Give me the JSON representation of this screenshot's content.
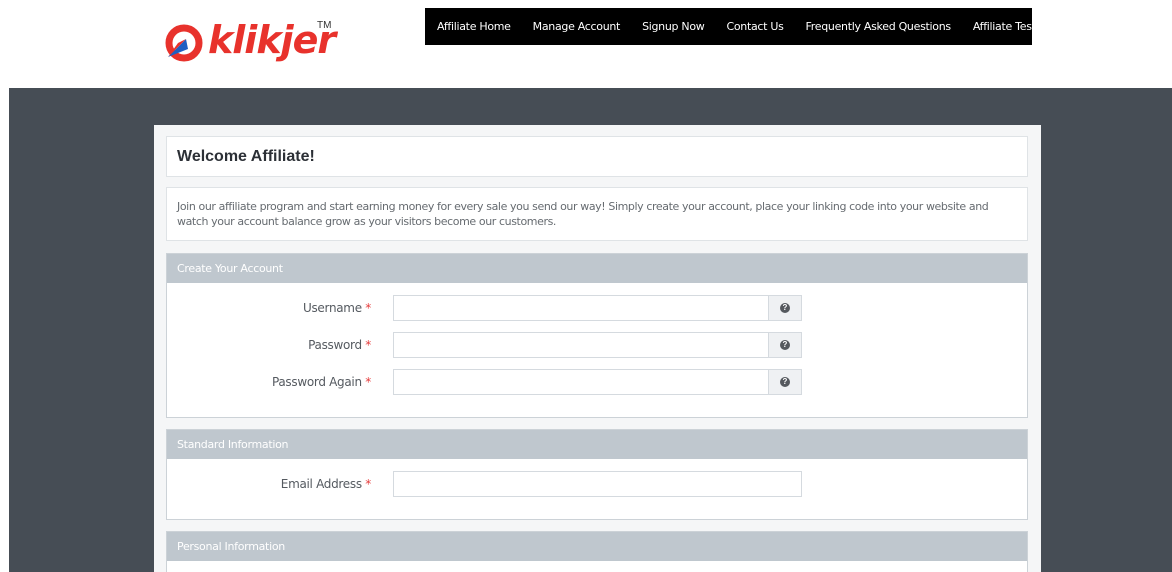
{
  "brand": {
    "name": "klikjer",
    "trademark": "TM",
    "color": "#e8322c"
  },
  "nav": [
    "Affiliate Home",
    "Manage Account",
    "Signup Now",
    "Contact Us",
    "Frequently Asked Questions",
    "Affiliate Testimonials"
  ],
  "welcome": {
    "title": "Welcome Affiliate!"
  },
  "intro": {
    "text": "Join our affiliate program and start earning money for every sale you send our way! Simply create your account, place your linking code into your website and watch your account balance grow as your visitors become our customers."
  },
  "sections": {
    "create_account": {
      "title": "Create Your Account",
      "fields": [
        {
          "label": "Username",
          "required_mark": "*",
          "value": "",
          "help_icon": "question-circle-icon"
        },
        {
          "label": "Password",
          "required_mark": "*",
          "value": "",
          "help_icon": "question-circle-icon"
        },
        {
          "label": "Password Again",
          "required_mark": "*",
          "value": "",
          "help_icon": "question-circle-icon"
        }
      ]
    },
    "standard_info": {
      "title": "Standard Information",
      "fields": [
        {
          "label": "Email Address",
          "required_mark": "*",
          "value": ""
        }
      ]
    },
    "personal_info": {
      "title": "Personal Information"
    }
  }
}
